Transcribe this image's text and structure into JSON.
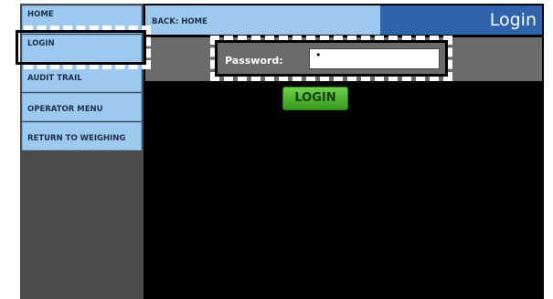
{
  "sidebar": {
    "items": [
      {
        "label": "HOME"
      },
      {
        "label": "LOGIN"
      },
      {
        "label": "AUDIT TRAIL"
      },
      {
        "label": "OPERATOR MENU"
      },
      {
        "label": "RETURN TO WEIGHING"
      }
    ]
  },
  "header": {
    "back_label": "BACK: HOME",
    "title": "Login"
  },
  "form": {
    "password_label": "Password:",
    "password_value": "•",
    "login_button": "LOGIN"
  },
  "colors": {
    "sidebar_item_bg": "#9ec9ee",
    "title_bar_bg": "#2f62ad",
    "login_button_green": "#4fb82c",
    "content_bg": "#000000"
  }
}
